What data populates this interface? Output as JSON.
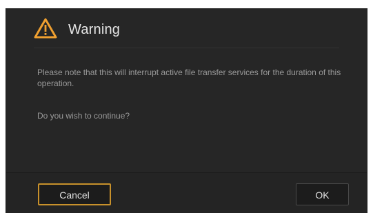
{
  "dialog": {
    "title": "Warning",
    "message": "Please note that this will interrupt active file transfer services for the duration of this operation.",
    "question": "Do you wish to continue?",
    "icon": "warning-icon",
    "accent_color": "#f0a030"
  },
  "buttons": {
    "cancel_label": "Cancel",
    "ok_label": "OK",
    "cancel_border_color": "#c8912b"
  }
}
